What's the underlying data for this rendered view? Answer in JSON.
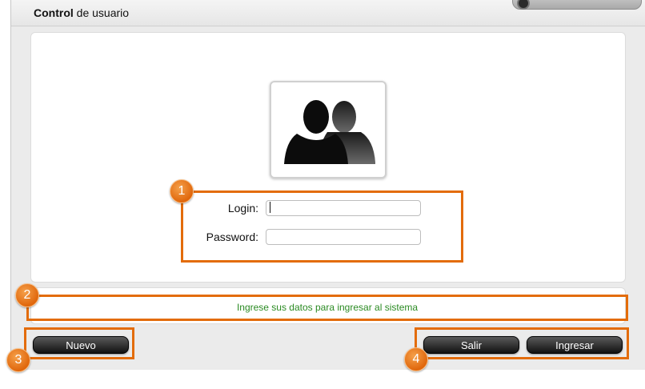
{
  "window": {
    "title_bold": "Control",
    "title_rest": " de usuario"
  },
  "form": {
    "login_label": "Login:",
    "login_value": "",
    "password_label": "Password:",
    "password_value": ""
  },
  "status": {
    "message": "Ingrese sus datos para ingresar al sistema",
    "color": "#2a8a22"
  },
  "buttons": {
    "nuevo": "Nuevo",
    "salir": "Salir",
    "ingresar": "Ingresar"
  },
  "callouts": {
    "color": "#e36c0a",
    "markers": [
      "1",
      "2",
      "3",
      "4"
    ]
  },
  "icons": {
    "avatar": "users-icon"
  }
}
